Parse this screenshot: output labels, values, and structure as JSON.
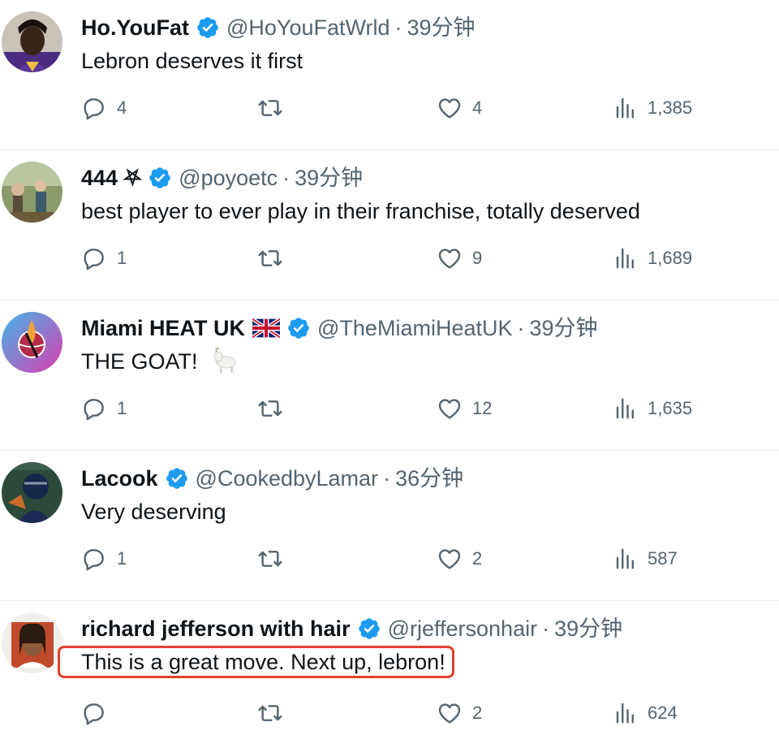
{
  "tweets": [
    {
      "name": "Ho.YouFat",
      "handle": "@HoYouFatWrld",
      "separator": "·",
      "time": "39分钟",
      "text": "Lebron deserves it first",
      "replies": "4",
      "retweets": "",
      "likes": "4",
      "views": "1,385",
      "avatar_color": "#3b2a5c"
    },
    {
      "name": "444 ⛧",
      "handle": "@poyoetc",
      "separator": "·",
      "time": "39分钟",
      "text": "best player to ever play in their franchise, totally deserved",
      "replies": "1",
      "retweets": "",
      "likes": "9",
      "views": "1,689",
      "avatar_color": "#6e7a4a"
    },
    {
      "name": "Miami HEAT UK",
      "flag": "🇬🇧",
      "handle": "@TheMiamiHeatUK",
      "separator": "·",
      "time": "39分钟",
      "text": "THE GOAT!",
      "replies": "1",
      "retweets": "",
      "likes": "12",
      "views": "1,635",
      "avatar_color": "#e23a8a"
    },
    {
      "name": "Lacook",
      "handle": "@CookedbyLamar",
      "separator": "·",
      "time": "36分钟",
      "text": "Very deserving",
      "replies": "1",
      "retweets": "",
      "likes": "2",
      "views": "587",
      "avatar_color": "#1c3b5a"
    },
    {
      "name": "richard jefferson with hair",
      "handle": "@rjeffersonhair",
      "separator": "·",
      "time": "39分钟",
      "text": "This is a great move. Next up, lebron!",
      "replies": "",
      "retweets": "",
      "likes": "2",
      "views": "624",
      "avatar_color": "#7a4e2e"
    }
  ],
  "colors": {
    "verified": "#1d9bf0",
    "secondary_text": "#536471",
    "highlight_border": "#e0402e",
    "divider": "#e6e9ea"
  },
  "icons": {
    "reply": "reply-icon",
    "retweet": "retweet-icon",
    "like": "heart-icon",
    "views": "views-icon",
    "verified": "verified-badge-icon",
    "goat": "goat-emoji-icon"
  }
}
